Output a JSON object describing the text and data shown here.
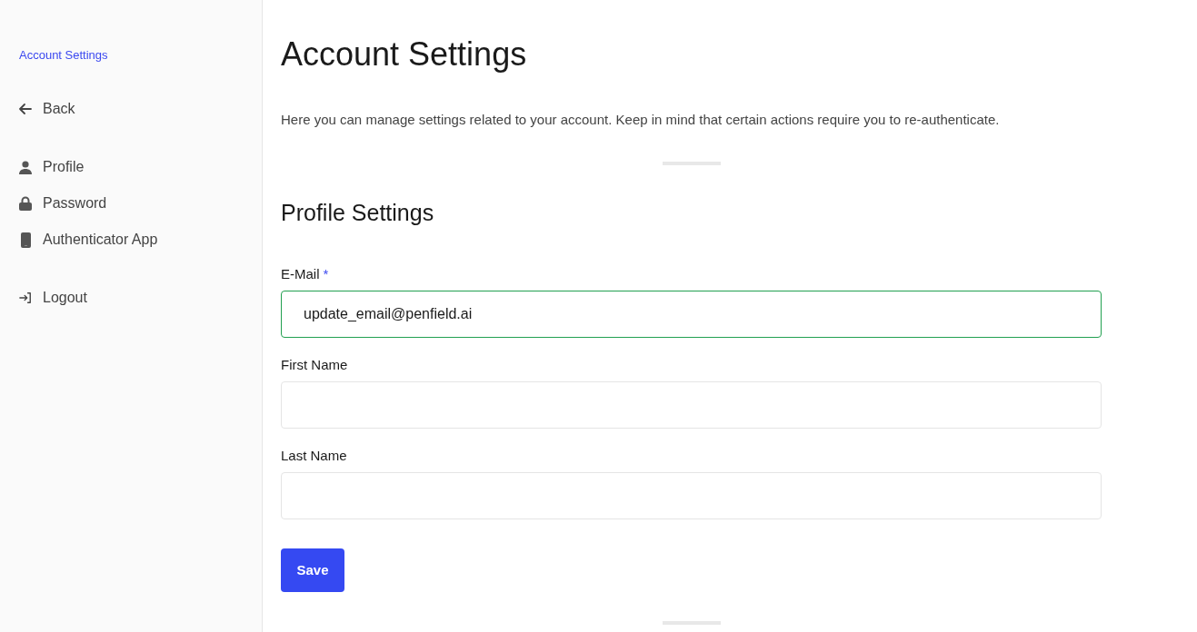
{
  "sidebar": {
    "title": "Account Settings",
    "groups": [
      {
        "items": [
          {
            "label": "Back"
          }
        ]
      },
      {
        "items": [
          {
            "label": "Profile"
          },
          {
            "label": "Password"
          },
          {
            "label": "Authenticator App"
          }
        ]
      },
      {
        "items": [
          {
            "label": "Logout"
          }
        ]
      }
    ]
  },
  "heading": "Account Settings",
  "intro": "Here you can manage settings related to your account. Keep in mind that certain actions require you to re-authenticate.",
  "section": {
    "title": "Profile Settings",
    "fields": [
      {
        "label": "E-Mail",
        "required_mark": "*",
        "focused": true,
        "value": "update_email@penfield.ai"
      },
      {
        "label": "First Name",
        "focused": false
      },
      {
        "label": "Last Name",
        "focused": false
      }
    ],
    "button": "Save"
  }
}
